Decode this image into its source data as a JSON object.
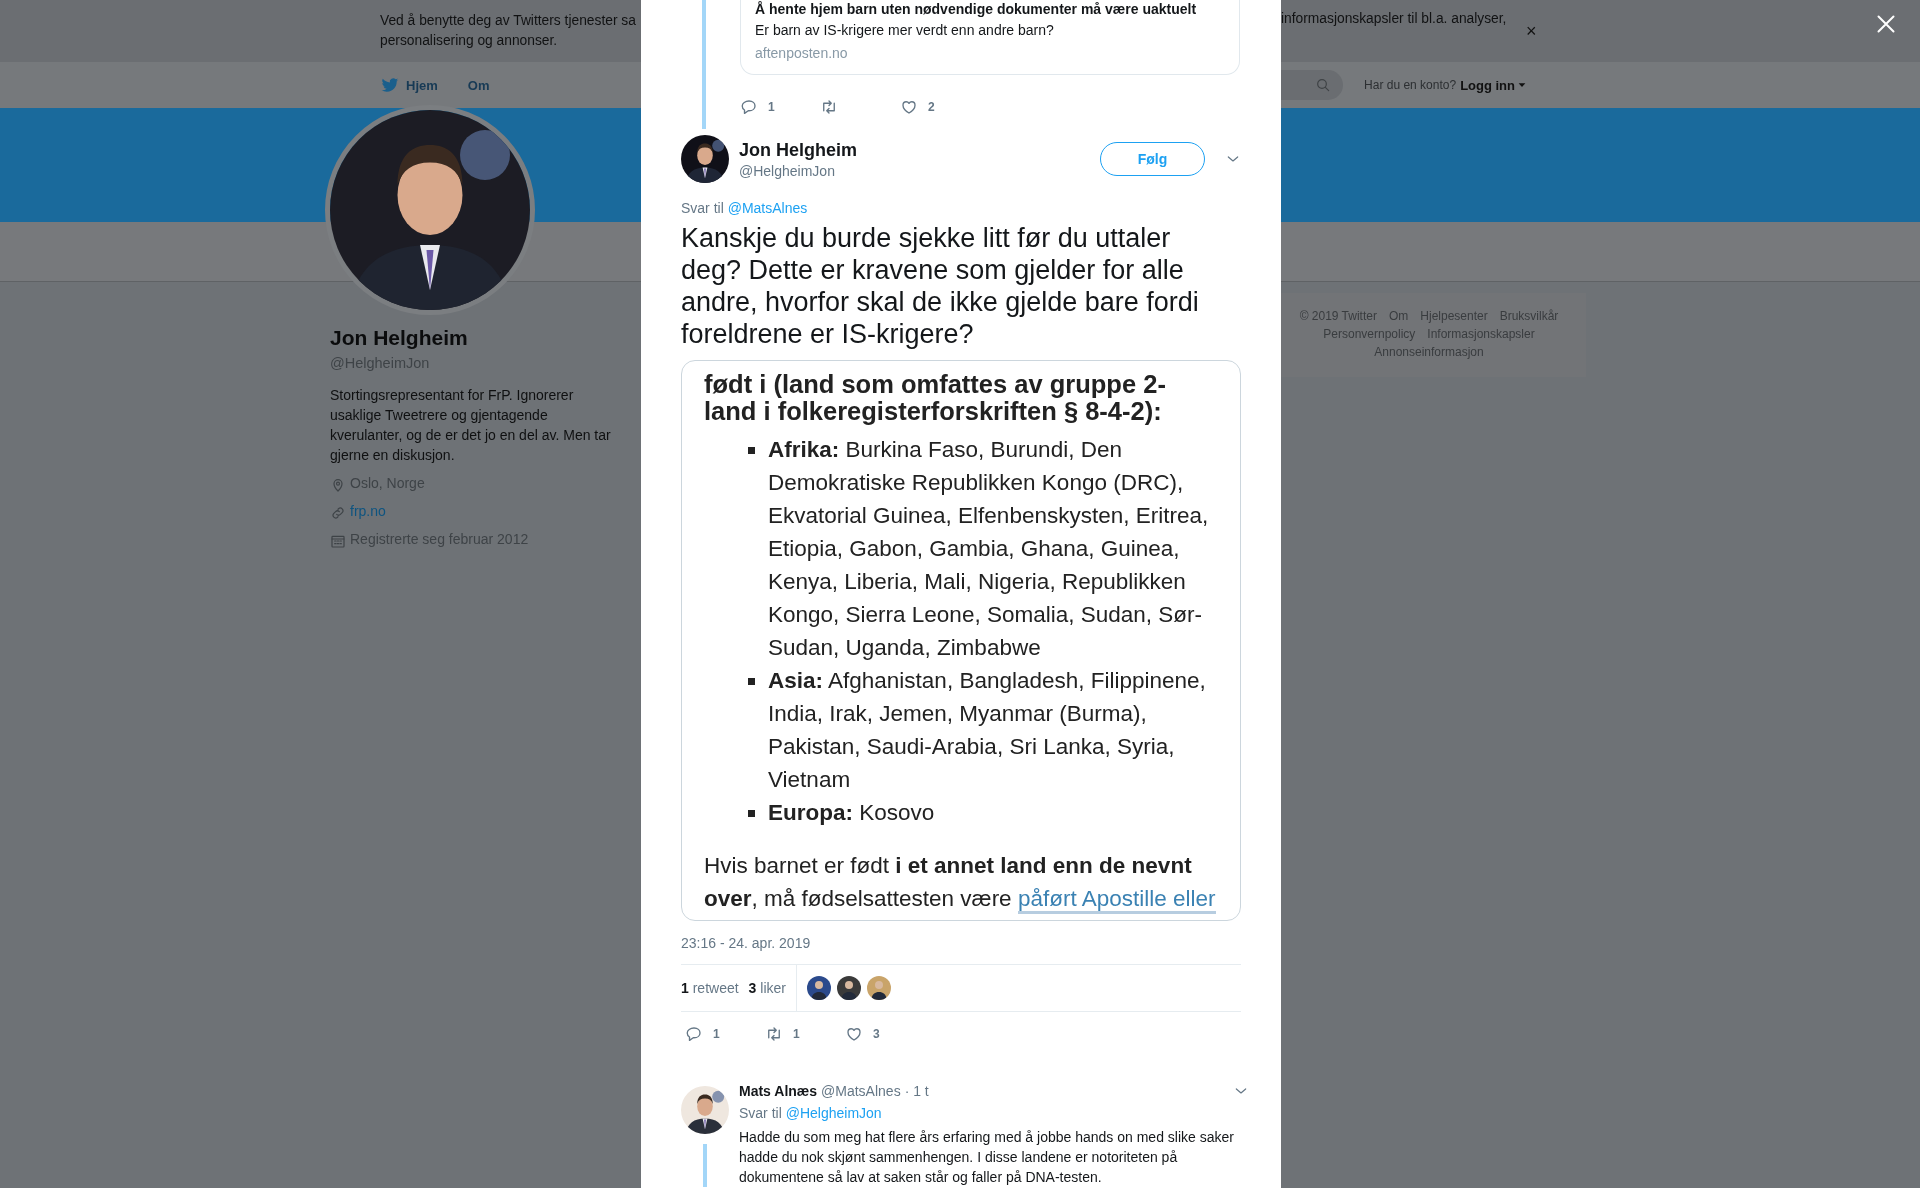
{
  "cookie_banner": {
    "text_left_lines": [
      "Ved å benytte deg av Twitters tjenester sa",
      "personalisering og annonser."
    ],
    "text_right": "informasjonskapsler til bl.a. analyser,",
    "close": "×"
  },
  "nav": {
    "items": [
      {
        "kind": "home",
        "label": "Hjem"
      },
      {
        "kind": "about",
        "label": "Om"
      }
    ],
    "login_prompt": "Har du en konto?",
    "login_link": "Logg inn"
  },
  "profile": {
    "name": "Jon Helgheim",
    "handle": "@HelgheimJon",
    "bio": "Stortingsrepresentant for FrP. Ignorerer usaklige Tweetrere og gjentagende kverulanter, og de er det jo en del av. Men tar gjerne en diskusjon.",
    "meta": [
      {
        "kind": "location",
        "text": "Oslo, Norge"
      },
      {
        "kind": "link",
        "text": "frp.no"
      },
      {
        "kind": "joined",
        "text": "Registrerte seg februar 2012"
      }
    ]
  },
  "footer_links": [
    "© 2019 Twitter",
    "Om",
    "Hjelpesenter",
    "Bruksvilkår",
    "Personvernpolicy",
    "Informasjonskapsler",
    "Annonseinformasjon"
  ],
  "modal": {
    "quoted_card": {
      "title": "Å hente hjem barn uten nødvendige dokumenter må være uaktuelt",
      "description": "Er barn av IS-krigere mer verdt enn andre barn?",
      "domain": "aftenposten.no"
    },
    "parent_actions": [
      {
        "kind": "reply",
        "count": "1"
      },
      {
        "kind": "retweet"
      },
      {
        "kind": "like",
        "count": "2"
      }
    ],
    "tweet": {
      "name": "Jon Helgheim",
      "handle": "@HelgheimJon",
      "follow": "Følg",
      "reply_to_prefix": "Svar til",
      "reply_to": "@MatsAlnes",
      "text": "Kanskje du burde sjekke litt før du uttaler deg? Dette er kravene som gjelder for alle andre, hvorfor skal de ikke gjelde bare fordi foreldrene er IS-krigere?",
      "document": {
        "heading": "født i (land som omfattes av gruppe 2-land i folkeregisterforskriften § 8-4-2):",
        "bullets": [
          "**Afrika:**  Burkina Faso, Burundi, Den Demokratiske Republikken Kongo (DRC), Ekvatorial Guinea, Elfenbenskysten, Eritrea, Etiopia, Gabon, Gambia, Ghana, Guinea, Kenya, Liberia, Mali, Nigeria, Republikken Kongo, Sierra Leone, Somalia, Sudan, Sør-Sudan, Uganda, Zimbabwe",
          "**Asia:**  Afghanistan, Bangladesh, Filippinene, India, Irak, Jemen, Myanmar (Burma), Pakistan, Saudi-Arabia, Sri Lanka, Syria, Vietnam",
          "**Europa:** Kosovo"
        ],
        "paragraph": "Hvis barnet er født **i et annet land enn de nevnt over**, må fødselsattesten være",
        "link": "påført Apostille eller"
      },
      "timestamp": "23:16 - 24. apr. 2019",
      "stats": [
        {
          "count": "1",
          "label": "retweet"
        },
        {
          "count": "3",
          "label": "liker"
        }
      ],
      "actions": [
        {
          "kind": "reply",
          "count": "1"
        },
        {
          "kind": "retweet",
          "count": "1"
        },
        {
          "kind": "like",
          "count": "3"
        }
      ]
    },
    "reply": {
      "name": "Mats Alnæs",
      "handle": "@MatsAlnes",
      "time": "· 1 t",
      "reply_to_prefix": "Svar til",
      "reply_to": "@HelgheimJon",
      "text": "Hadde du som meg hat flere års erfaring med å jobbe hands on med slike saker hadde du nok skjønt sammenhengen. I disse landene er notoriteten på dokumentene så lav at saken står og faller på DNA-testen."
    }
  }
}
